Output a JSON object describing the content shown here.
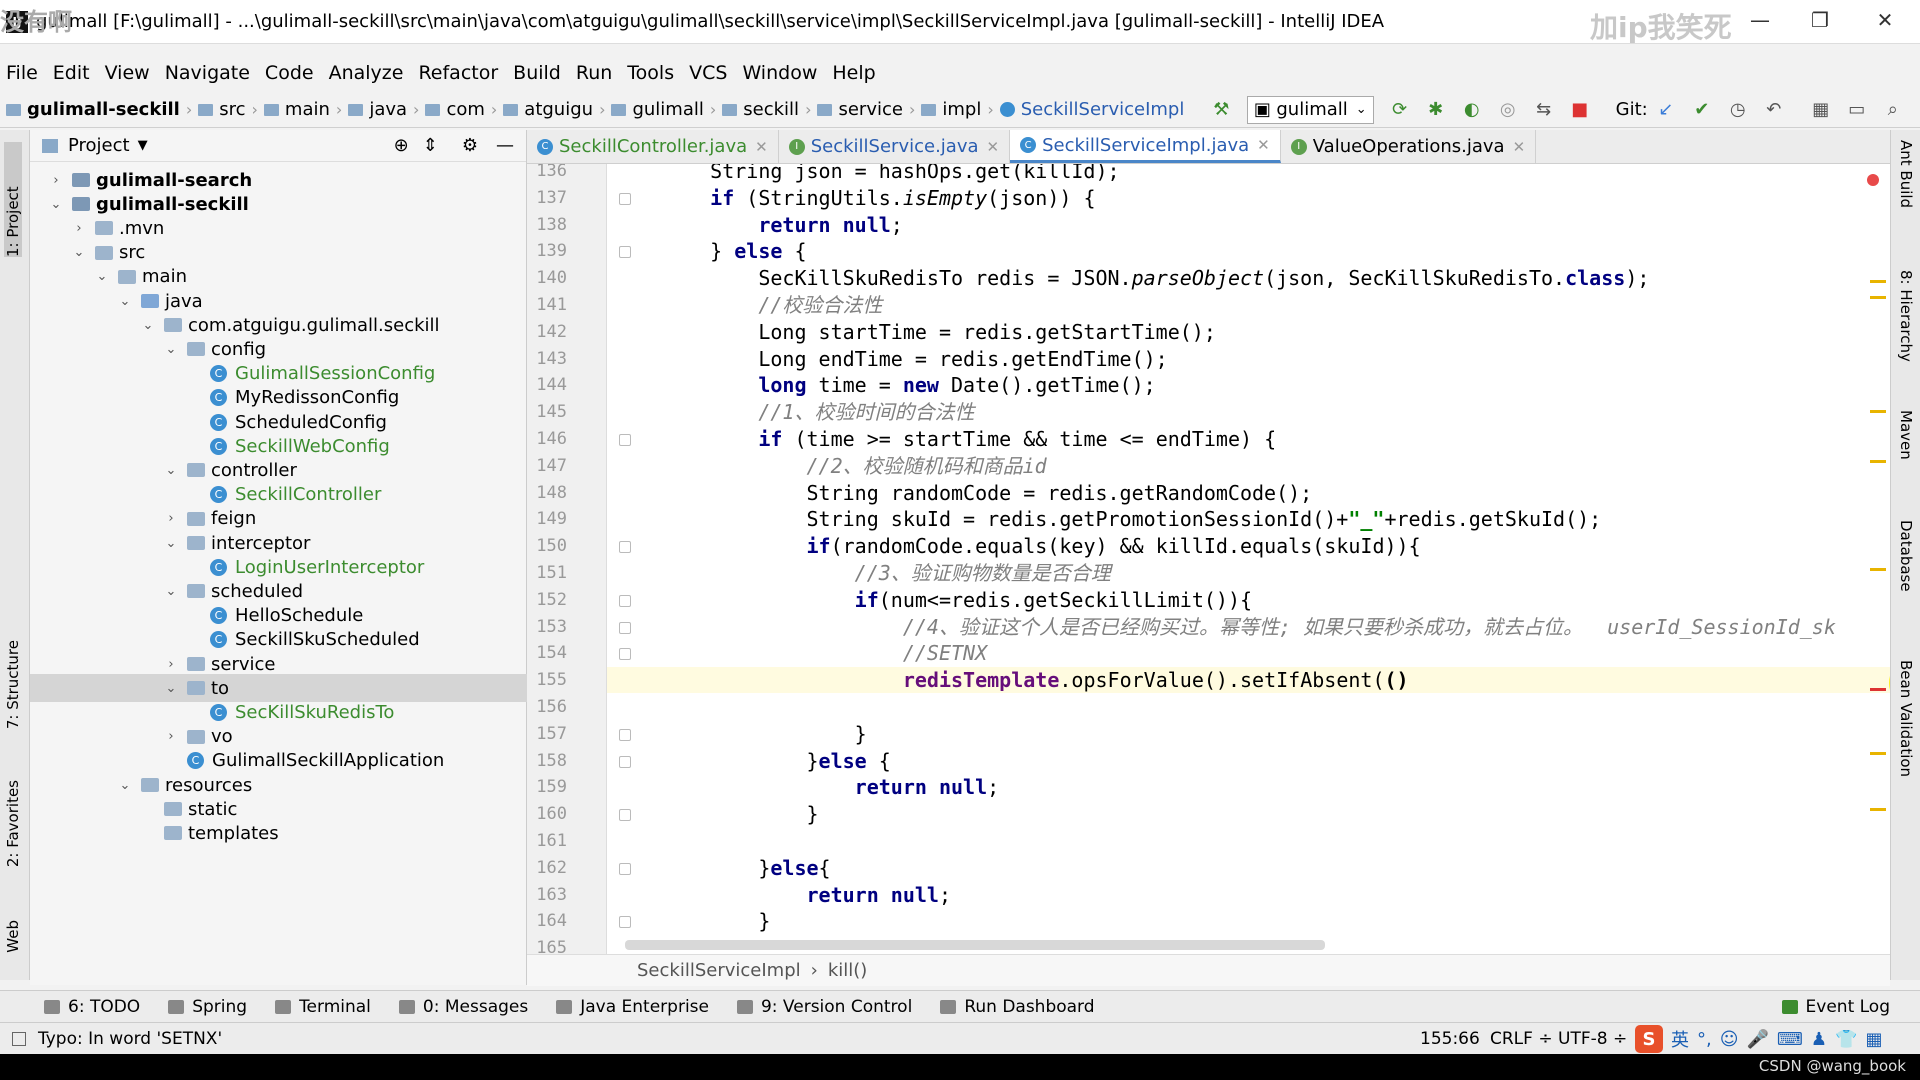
{
  "window": {
    "title": "gulimall [F:\\gulimall] - ...\\gulimall-seckill\\src\\main\\java\\com\\atguigu\\gulimall\\seckill\\service\\impl\\SeckillServiceImpl.java [gulimall-seckill] - IntelliJ IDEA",
    "watermark_right": "加ip我笑死",
    "watermark_left": "没有啊"
  },
  "menu": [
    "File",
    "Edit",
    "View",
    "Navigate",
    "Code",
    "Analyze",
    "Refactor",
    "Build",
    "Run",
    "Tools",
    "VCS",
    "Window",
    "Help"
  ],
  "breadcrumbs": [
    "gulimall-seckill",
    "src",
    "main",
    "java",
    "com",
    "atguigu",
    "gulimall",
    "seckill",
    "service",
    "impl",
    "SeckillServiceImpl"
  ],
  "toolbar": {
    "run_config": "gulimall",
    "git_label": "Git:"
  },
  "left_strip": {
    "project": "1: Project",
    "structure": "7: Structure",
    "favorites": "2: Favorites",
    "web": "Web"
  },
  "right_strip": {
    "ant": "Ant Build",
    "hierarchy": "8: Hierarchy",
    "maven": "Maven",
    "database": "Database",
    "bean": "Bean Validation"
  },
  "project_panel": {
    "title": "Project"
  },
  "tree": [
    {
      "label": "gulimall-search",
      "depth": 0,
      "arrow": "›",
      "type": "mod",
      "bold": true
    },
    {
      "label": "gulimall-seckill",
      "depth": 0,
      "arrow": "⌄",
      "type": "mod",
      "bold": true
    },
    {
      "label": ".mvn",
      "depth": 1,
      "arrow": "›",
      "type": "folder"
    },
    {
      "label": "src",
      "depth": 1,
      "arrow": "⌄",
      "type": "folder"
    },
    {
      "label": "main",
      "depth": 2,
      "arrow": "⌄",
      "type": "folder"
    },
    {
      "label": "java",
      "depth": 3,
      "arrow": "⌄",
      "type": "src"
    },
    {
      "label": "com.atguigu.gulimall.seckill",
      "depth": 4,
      "arrow": "⌄",
      "type": "folder"
    },
    {
      "label": "config",
      "depth": 5,
      "arrow": "⌄",
      "type": "folder"
    },
    {
      "label": "GulimallSessionConfig",
      "depth": 6,
      "arrow": "",
      "type": "class",
      "green": true
    },
    {
      "label": "MyRedissonConfig",
      "depth": 6,
      "arrow": "",
      "type": "class"
    },
    {
      "label": "ScheduledConfig",
      "depth": 6,
      "arrow": "",
      "type": "class"
    },
    {
      "label": "SeckillWebConfig",
      "depth": 6,
      "arrow": "",
      "type": "class",
      "green": true
    },
    {
      "label": "controller",
      "depth": 5,
      "arrow": "⌄",
      "type": "folder"
    },
    {
      "label": "SeckillController",
      "depth": 6,
      "arrow": "",
      "type": "class",
      "green": true
    },
    {
      "label": "feign",
      "depth": 5,
      "arrow": "›",
      "type": "folder"
    },
    {
      "label": "interceptor",
      "depth": 5,
      "arrow": "⌄",
      "type": "folder"
    },
    {
      "label": "LoginUserInterceptor",
      "depth": 6,
      "arrow": "",
      "type": "class",
      "green": true
    },
    {
      "label": "scheduled",
      "depth": 5,
      "arrow": "⌄",
      "type": "folder"
    },
    {
      "label": "HelloSchedule",
      "depth": 6,
      "arrow": "",
      "type": "class"
    },
    {
      "label": "SeckillSkuScheduled",
      "depth": 6,
      "arrow": "",
      "type": "class"
    },
    {
      "label": "service",
      "depth": 5,
      "arrow": "›",
      "type": "folder"
    },
    {
      "label": "to",
      "depth": 5,
      "arrow": "⌄",
      "type": "folder",
      "selected": true
    },
    {
      "label": "SecKillSkuRedisTo",
      "depth": 6,
      "arrow": "",
      "type": "class",
      "green": true
    },
    {
      "label": "vo",
      "depth": 5,
      "arrow": "›",
      "type": "folder"
    },
    {
      "label": "GulimallSeckillApplication",
      "depth": 5,
      "arrow": "",
      "type": "class"
    },
    {
      "label": "resources",
      "depth": 3,
      "arrow": "⌄",
      "type": "folder"
    },
    {
      "label": "static",
      "depth": 4,
      "arrow": "",
      "type": "folder"
    },
    {
      "label": "templates",
      "depth": 4,
      "arrow": "",
      "type": "folder"
    }
  ],
  "tabs": [
    {
      "label": "SeckillController.java",
      "icon": "C",
      "color": "#3b8fd1",
      "green": true
    },
    {
      "label": "SeckillService.java",
      "icon": "I",
      "color": "#5ea04f",
      "green": false
    },
    {
      "label": "SeckillServiceImpl.java",
      "icon": "C",
      "color": "#3b8fd1",
      "green": false,
      "active": true
    },
    {
      "label": "ValueOperations.java",
      "icon": "I",
      "color": "#5ea04f",
      "green": false
    }
  ],
  "code_lines": [
    {
      "n": "136",
      "html": "    String json = hashOps.get(killId);"
    },
    {
      "n": "137",
      "html": "    <span class='kw'>if</span> (StringUtils.<span class='it'>isEmpty</span>(json)) {"
    },
    {
      "n": "138",
      "html": "        <span class='kw'>return null</span>;"
    },
    {
      "n": "139",
      "html": "    } <span class='kw'>else</span> {"
    },
    {
      "n": "140",
      "html": "        SecKillSkuRedisTo redis = JSON.<span class='it'>parseObject</span>(json, SecKillSkuRedisTo.<span class='kw'>class</span>);"
    },
    {
      "n": "141",
      "html": "        <span class='cm'>//校验合法性</span>"
    },
    {
      "n": "142",
      "html": "        Long startTime = redis.getStartTime();"
    },
    {
      "n": "143",
      "html": "        Long endTime = redis.getEndTime();"
    },
    {
      "n": "144",
      "html": "        <span class='kw'>long</span> time = <span class='kw'>new</span> Date().getTime();"
    },
    {
      "n": "145",
      "html": "        <span class='cm'>//1、校验时间的合法性</span>"
    },
    {
      "n": "146",
      "html": "        <span class='kw'>if</span> (time &gt;= startTime &amp;&amp; time &lt;= endTime) {"
    },
    {
      "n": "147",
      "html": "            <span class='cm'>//2、校验随机码和商品id</span>"
    },
    {
      "n": "148",
      "html": "            String randomCode = redis.getRandomCode();"
    },
    {
      "n": "149",
      "html": "            String skuId = redis.getPromotionSessionId()+<span class='str'>\"_\"</span>+redis.getSkuId();"
    },
    {
      "n": "150",
      "html": "            <span class='kw'>if</span>(randomCode.equals(key) &amp;&amp; killId.equals(skuId)){"
    },
    {
      "n": "151",
      "html": "                <span class='cm'>//3、验证购物数量是否合理</span>"
    },
    {
      "n": "152",
      "html": "                <span class='kw'>if</span>(num&lt;=redis.getSeckillLimit()){"
    },
    {
      "n": "153",
      "html": "                    <span class='cm'>//4、验证这个人是否已经购买过。幂等性; 如果只要秒杀成功，就去占位。  userId_SessionId_sk</span>"
    },
    {
      "n": "154",
      "html": "                    <span class='cm'>//SETNX</span>"
    },
    {
      "n": "155",
      "html": "                    <span class='fld'>redisTemplate</span>.opsForValue().setIfAbsent(<b>()</b>"
    },
    {
      "n": "156",
      "html": ""
    },
    {
      "n": "157",
      "html": "                }"
    },
    {
      "n": "158",
      "html": "            }<span class='kw'>else</span> {"
    },
    {
      "n": "159",
      "html": "                <span class='kw'>return null</span>;"
    },
    {
      "n": "160",
      "html": "            }"
    },
    {
      "n": "161",
      "html": ""
    },
    {
      "n": "162",
      "html": "        }<span class='kw'>else</span>{"
    },
    {
      "n": "163",
      "html": "            <span class='kw'>return null</span>;"
    },
    {
      "n": "164",
      "html": "        }"
    },
    {
      "n": "165",
      "html": ""
    }
  ],
  "editor_breadcrumb": {
    "class": "SeckillServiceImpl",
    "sep": "›",
    "method": "kill()"
  },
  "bottom_tabs": [
    "6: TODO",
    "Spring",
    "Terminal",
    "0: Messages",
    "Java Enterprise",
    "9: Version Control",
    "Run Dashboard"
  ],
  "event_log": "Event Log",
  "status": {
    "message": "Typo: In word 'SETNX'",
    "position": "155:66",
    "line_sep": "CRLF ÷",
    "encoding": "UTF-8 ÷",
    "ime_lang": "英"
  },
  "credit": "CSDN @wang_book",
  "colors": {
    "accent": "#4a86c8",
    "highlight": "#ffee00",
    "error": "#e84a4a"
  }
}
